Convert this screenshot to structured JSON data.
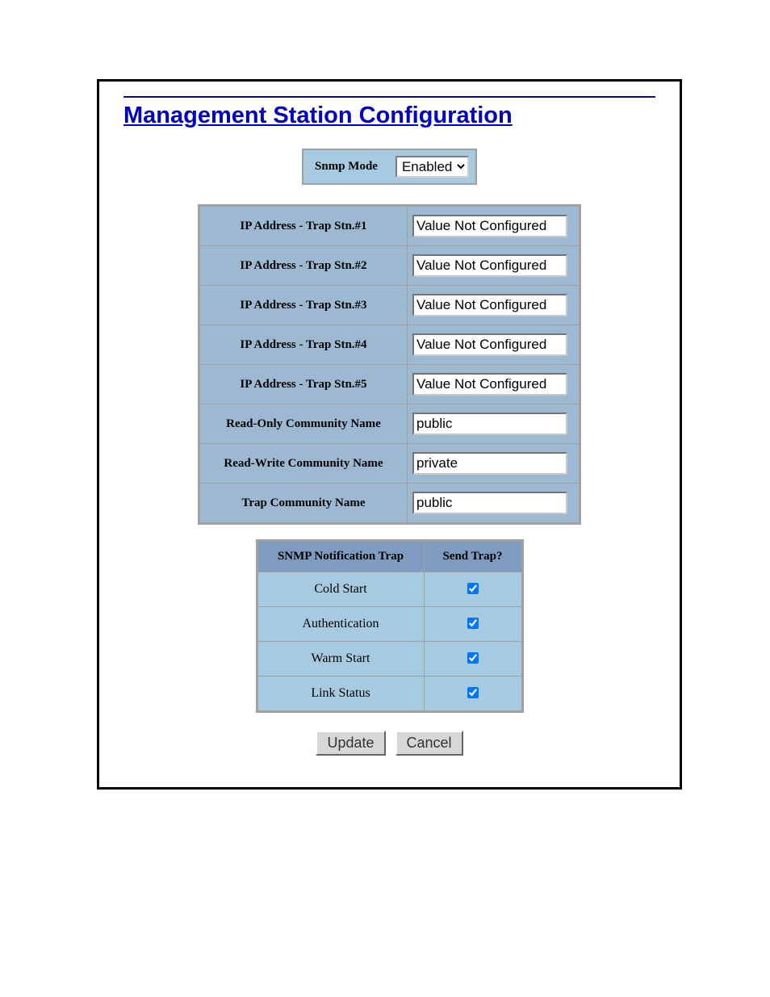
{
  "title": "Management Station Configuration",
  "snmp_mode": {
    "label": "Snmp Mode",
    "value": "Enabled"
  },
  "config_rows": [
    {
      "label": "IP Address - Trap Stn.#1",
      "value": "Value Not Configured"
    },
    {
      "label": "IP Address - Trap Stn.#2",
      "value": "Value Not Configured"
    },
    {
      "label": "IP Address - Trap Stn.#3",
      "value": "Value Not Configured"
    },
    {
      "label": "IP Address - Trap Stn.#4",
      "value": "Value Not Configured"
    },
    {
      "label": "IP Address - Trap Stn.#5",
      "value": "Value Not Configured"
    },
    {
      "label": "Read-Only Community Name",
      "value": "public"
    },
    {
      "label": "Read-Write Community Name",
      "value": "private"
    },
    {
      "label": "Trap Community Name",
      "value": "public"
    }
  ],
  "trap_table": {
    "headers": {
      "trap": "SNMP Notification Trap",
      "send": "Send Trap?"
    },
    "rows": [
      {
        "name": "Cold Start",
        "checked": true
      },
      {
        "name": "Authentication",
        "checked": true
      },
      {
        "name": "Warm Start",
        "checked": true
      },
      {
        "name": "Link Status",
        "checked": true
      }
    ]
  },
  "buttons": {
    "update": "Update",
    "cancel": "Cancel"
  }
}
